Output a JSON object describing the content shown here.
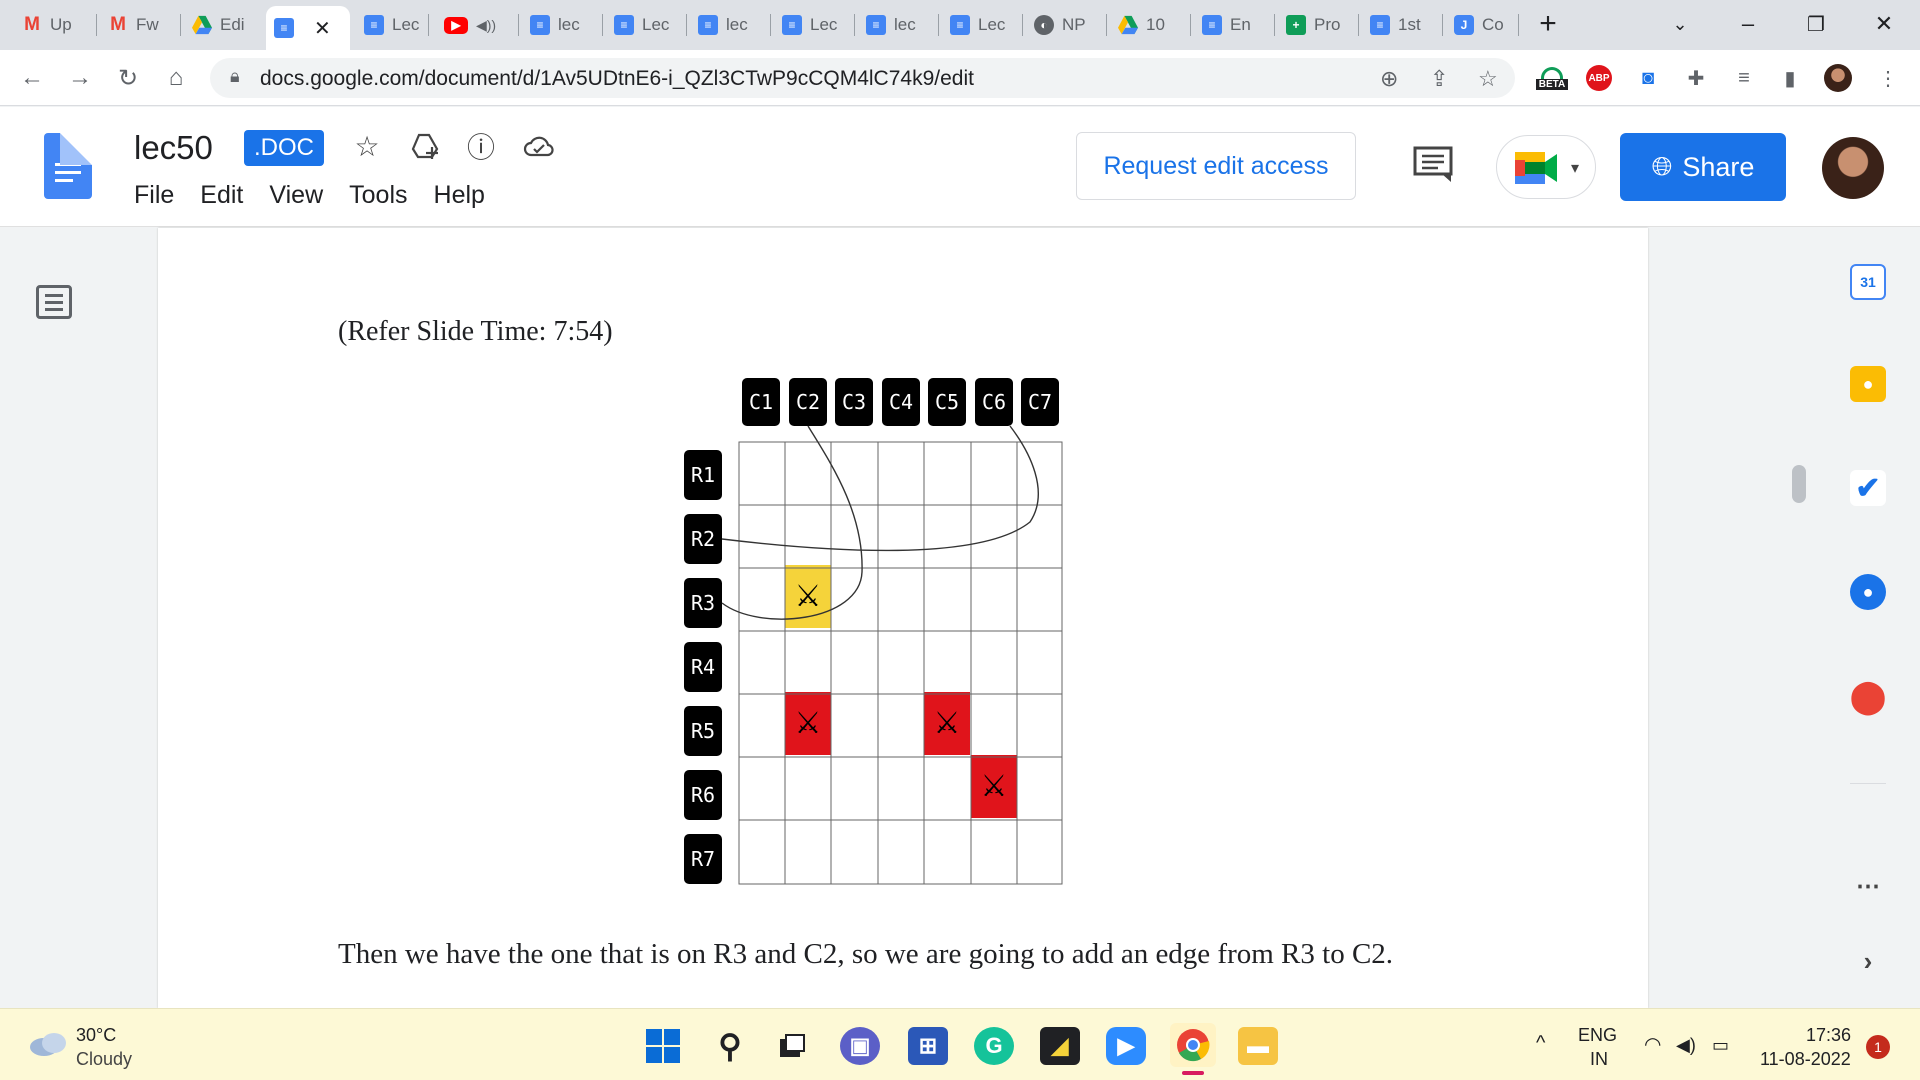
{
  "browser": {
    "tabs": [
      {
        "label": "Up",
        "icon": "gmail-icon"
      },
      {
        "label": "Fw",
        "icon": "gmail-icon"
      },
      {
        "label": "Edi",
        "icon": "drive-icon"
      },
      {
        "label": "",
        "icon": "docs-icon",
        "active": true
      },
      {
        "label": "Lec",
        "icon": "docs-icon"
      },
      {
        "label": "",
        "icon": "youtube-icon"
      },
      {
        "label": "lec",
        "icon": "docs-icon"
      },
      {
        "label": "Lec",
        "icon": "docs-icon"
      },
      {
        "label": "lec",
        "icon": "docs-icon"
      },
      {
        "label": "Lec",
        "icon": "docs-icon"
      },
      {
        "label": "lec",
        "icon": "docs-icon"
      },
      {
        "label": "Lec",
        "icon": "docs-icon"
      },
      {
        "label": "NP",
        "icon": "globe-icon"
      },
      {
        "label": "10",
        "icon": "drive-icon"
      },
      {
        "label": "En",
        "icon": "docs-icon"
      },
      {
        "label": "Pro",
        "icon": "sheets-icon"
      },
      {
        "label": "1st",
        "icon": "docs-icon"
      },
      {
        "label": "Co",
        "icon": "jamboard-icon"
      }
    ],
    "url": "docs.google.com/document/d/1Av5UDtnE6-i_QZl3CTwP9cCQM4lC74k9/edit",
    "beta_badge": "BETA",
    "abp_badge": "ABP"
  },
  "docs": {
    "title": "lec50",
    "badge": ".DOC",
    "menu": [
      "File",
      "Edit",
      "View",
      "Tools",
      "Help"
    ],
    "request_edit": "Request edit access",
    "share": "Share"
  },
  "document": {
    "caption": "(Refer Slide Time: 7:54)",
    "body": "Then we have the one that is on R3 and C2, so we are going to add an edge from R3 to C2."
  },
  "diagram": {
    "columns": [
      "C1",
      "C2",
      "C3",
      "C4",
      "C5",
      "C6",
      "C7"
    ],
    "rows": [
      "R1",
      "R2",
      "R3",
      "R4",
      "R5",
      "R6",
      "R7"
    ],
    "highlighted_cells": [
      {
        "row": "R3",
        "col": "C2",
        "color": "#f5d33a"
      },
      {
        "row": "R5",
        "col": "C2",
        "color": "#e0141b"
      },
      {
        "row": "R5",
        "col": "C5",
        "color": "#e0141b"
      },
      {
        "row": "R6",
        "col": "C6",
        "color": "#e0141b"
      }
    ],
    "edges": [
      {
        "from": "R2",
        "to": "C6"
      },
      {
        "from": "R3",
        "to": "C2"
      }
    ],
    "cell_icon": "crossed-swords-icon"
  },
  "taskbar": {
    "weather_temp": "30°C",
    "weather_desc": "Cloudy",
    "lang_top": "ENG",
    "lang_bottom": "IN",
    "time": "17:36",
    "date": "11-08-2022",
    "notification_count": "1"
  }
}
